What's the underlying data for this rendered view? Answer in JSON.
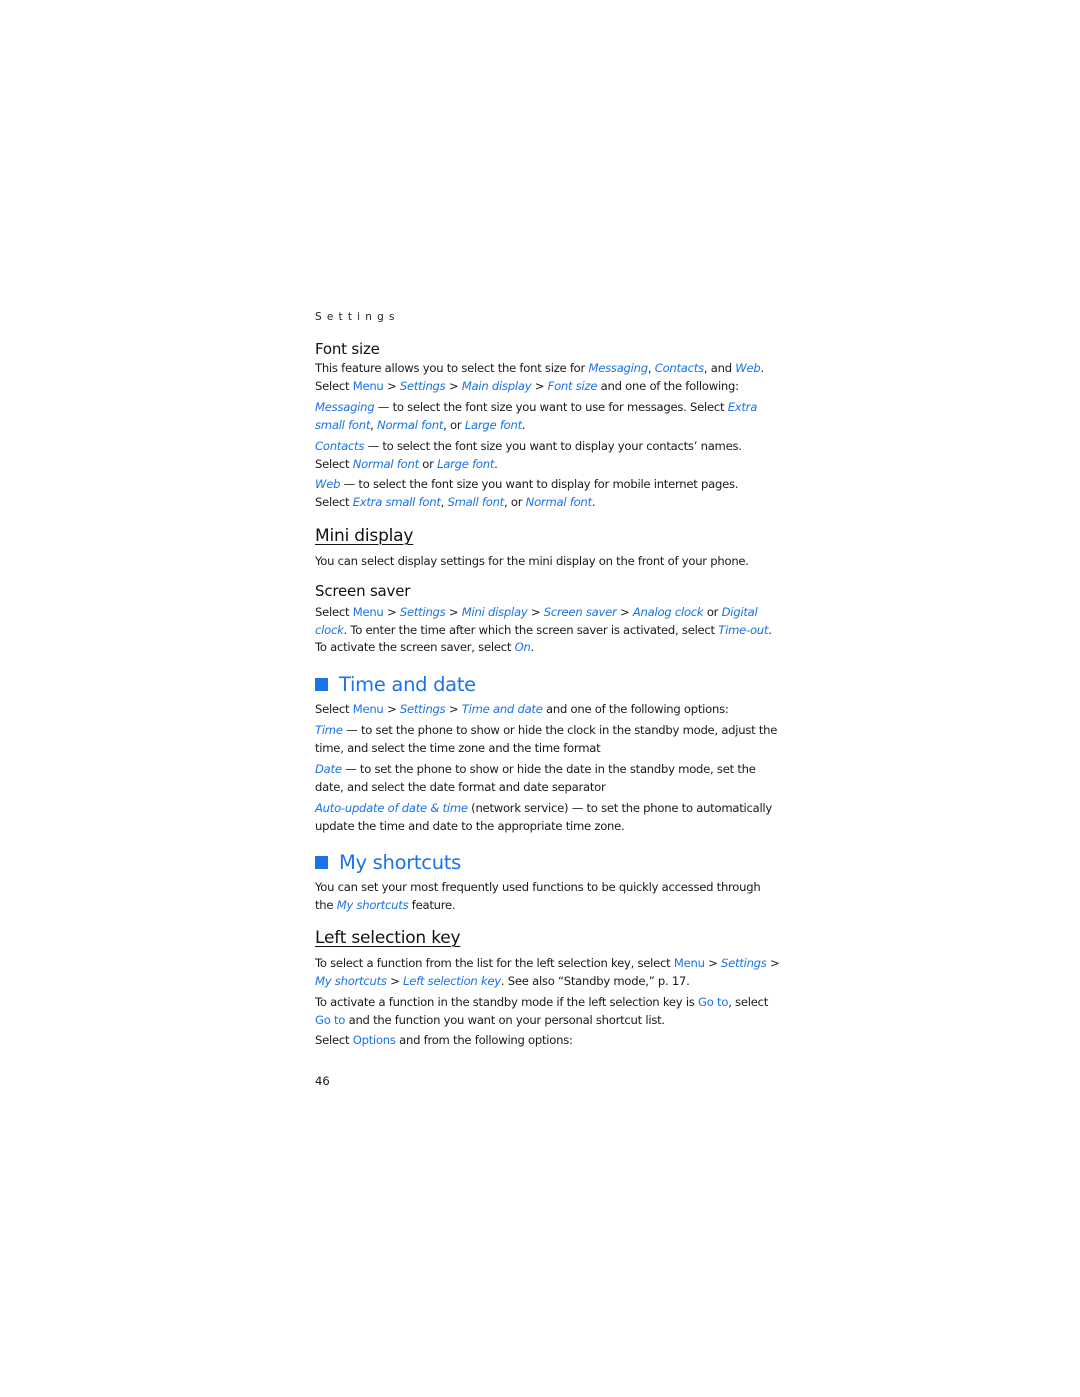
{
  "running_head": "Settings",
  "page_number": "46",
  "colors": {
    "accent": "#1a73e8",
    "text": "#1a1a1a"
  },
  "font_size": {
    "title": "Font size",
    "intro_1": "This feature allows you to select the font size for ",
    "messaging": "Messaging",
    "comma": ", ",
    "contacts": "Contacts",
    "and": ", and ",
    "web": "Web",
    "period": ".",
    "select": "Select ",
    "menu": "Menu",
    "gt": " > ",
    "settings": "Settings",
    "main_display": "Main display",
    "font_size": "Font size",
    "one_of": " and one of the following:",
    "messaging_desc": " — to select the font size you want to use for messages. Select ",
    "extra": "Extra",
    "small_font": "small font",
    "normal_font": "Normal font",
    "or": ", or ",
    "large_font": "Large font",
    "contacts_desc": " — to select the font size you want to display your contacts’ names.",
    "or2": " or ",
    "web_desc": " — to select the font size you want to display for mobile internet pages.",
    "extra_small_font": "Extra small font",
    "small_font_cap": "Small font"
  },
  "mini_display": {
    "title": "Mini display",
    "intro": "You can select display settings for the mini display on the front of your phone."
  },
  "screen_saver": {
    "title": "Screen saver",
    "select": "Select ",
    "menu": "Menu",
    "gt": " > ",
    "settings": "Settings",
    "mini_display": "Mini display",
    "screen_saver": "Screen saver",
    "analog_clock": "Analog clock",
    "or": " or ",
    "digital": "Digital",
    "clock": "clock",
    "time_out_text": ". To enter the time after which the screen saver is activated, select ",
    "time_out": "Time-out",
    "period": ".",
    "activate_text": "To activate the screen saver, select ",
    "on": "On"
  },
  "time_and_date": {
    "title": "Time and date",
    "select": "Select ",
    "menu": "Menu",
    "gt": " > ",
    "settings": "Settings",
    "time_and_date": "Time and date",
    "one_of": " and one of the following options:",
    "time": "Time",
    "time_desc_1": " — to set the phone to show or hide the clock in the standby mode, adjust the",
    "time_desc_2": "time, and select the time zone and the time format",
    "date": "Date",
    "date_desc_1": " — to set the phone to show or hide the date in the standby mode, set the",
    "date_desc_2": "date, and select the date format and date separator",
    "auto_update": "Auto-update of date & time",
    "auto_desc_1": " (network service) — to set the phone to automatically",
    "auto_desc_2": "update the time and date to the appropriate time zone."
  },
  "my_shortcuts": {
    "title": "My shortcuts",
    "intro_1": "You can set your most frequently used functions to be quickly accessed through",
    "the": "the ",
    "my_shortcuts": "My shortcuts",
    "feature": " feature."
  },
  "left_selection_key": {
    "title": "Left selection key",
    "p1_a": "To select a function from the list for the left selection key, select ",
    "menu": "Menu",
    "gt": " > ",
    "settings": "Settings",
    "gt_end": " >",
    "my_shortcuts": "My shortcuts",
    "left_selection_key": "Left selection key",
    "see_also": ". See also “Standby mode,” p. 17.",
    "p2_a": "To activate a function in the standby mode if the left selection key is ",
    "go_to": "Go to",
    "p2_b": ", select",
    "p2_c": " and the function you want on your personal shortcut list.",
    "p3_a": "Select ",
    "options": "Options",
    "p3_b": " and from the following options:"
  }
}
